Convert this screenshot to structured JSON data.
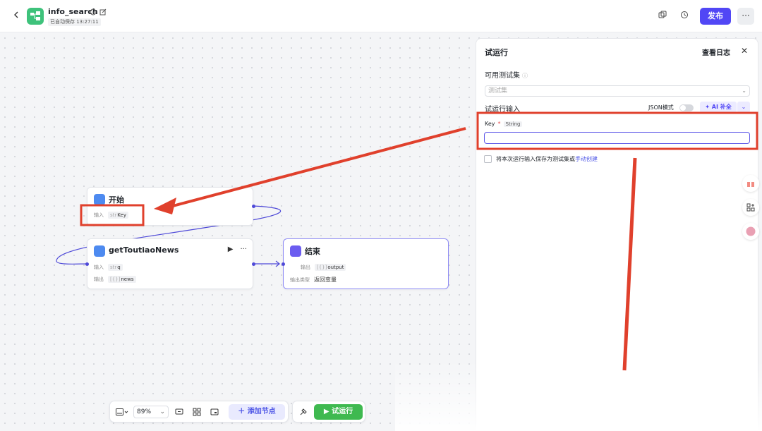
{
  "header": {
    "app_title": "info_search",
    "autosave": "已自动保存 13:27:11",
    "publish_label": "发布",
    "more_label": "···"
  },
  "canvas": {
    "nodes": {
      "start": {
        "title": "开始",
        "input_label": "输入",
        "input_type": "str",
        "input_name": "Key"
      },
      "plugin": {
        "title": "getToutiaoNews",
        "input_label": "输入",
        "input_type": "str",
        "input_name": "q",
        "output_label": "输出",
        "output_type": "[{}]",
        "output_name": "news"
      },
      "end": {
        "title": "结束",
        "output_label": "输出",
        "output_type": "[{}]",
        "output_name": "output",
        "output_kind_label": "输出类型",
        "output_kind_value": "返回变量"
      }
    }
  },
  "panel": {
    "title": "试运行",
    "log_label": "查看日志",
    "testset_label": "可用测试集",
    "testset_placeholder": "测试集",
    "input_section_label": "试运行输入",
    "json_mode_label": "JSON模式",
    "ai_fill_label": "AI 补全",
    "key_label": "Key",
    "key_required": "*",
    "key_type": "String",
    "key_value": "",
    "save_checkbox_text": "将本次运行输入保存为测试集或",
    "manual_create_link": "手动创建"
  },
  "toolbar": {
    "zoom": "89%",
    "add_node_label": "添加节点",
    "run_label": "试运行"
  },
  "colors": {
    "accent": "#5147f5",
    "run_green": "#3fb950",
    "annotation_red": "#e0402c",
    "edge": "#4e49d8"
  }
}
